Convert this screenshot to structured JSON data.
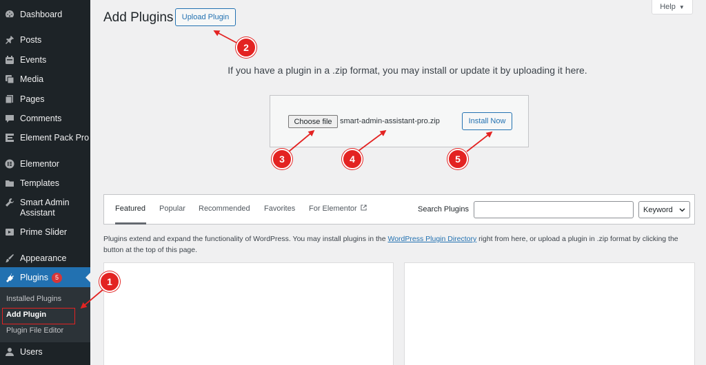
{
  "sidebar": {
    "items": [
      {
        "label": "Dashboard",
        "icon": "dashboard-icon"
      },
      {
        "label": "Posts",
        "icon": "pin-icon"
      },
      {
        "label": "Events",
        "icon": "events-icon"
      },
      {
        "label": "Media",
        "icon": "media-icon"
      },
      {
        "label": "Pages",
        "icon": "pages-icon"
      },
      {
        "label": "Comments",
        "icon": "comment-icon"
      },
      {
        "label": "Element Pack Pro",
        "icon": "element-pack-icon"
      },
      {
        "label": "Elementor",
        "icon": "elementor-icon"
      },
      {
        "label": "Templates",
        "icon": "folder-icon"
      },
      {
        "label": "Smart Admin Assistant",
        "icon": "wrench-icon"
      },
      {
        "label": "Prime Slider",
        "icon": "slider-icon"
      },
      {
        "label": "Appearance",
        "icon": "brush-icon"
      },
      {
        "label": "Plugins",
        "icon": "plugin-icon",
        "badge": "5",
        "active": true
      },
      {
        "label": "Users",
        "icon": "user-icon"
      }
    ],
    "submenu": [
      "Installed Plugins",
      "Add Plugin",
      "Plugin File Editor"
    ],
    "active_color": "#2271b1"
  },
  "header": {
    "title": "Add Plugins",
    "upload_button": "Upload Plugin",
    "help_button": "Help"
  },
  "upload": {
    "help_text": "If you have a plugin in a .zip format, you may install or update it by uploading it here.",
    "choose_file": "Choose file",
    "file_name": "smart-admin-assistant-pro.zip",
    "install_button": "Install Now"
  },
  "filter": {
    "tabs": [
      "Featured",
      "Popular",
      "Recommended",
      "Favorites",
      "For Elementor"
    ],
    "search_label": "Search Plugins",
    "search_value": "",
    "keyword_select": "Keyword"
  },
  "intro": {
    "before": "Plugins extend and expand the functionality of WordPress. You may install plugins in the ",
    "link": "WordPress Plugin Directory",
    "after": " right from here, or upload a plugin in .zip format by clicking the button at the top of this page."
  },
  "annotations": [
    "1",
    "2",
    "3",
    "4",
    "5"
  ],
  "annotation_color": "#e32322"
}
